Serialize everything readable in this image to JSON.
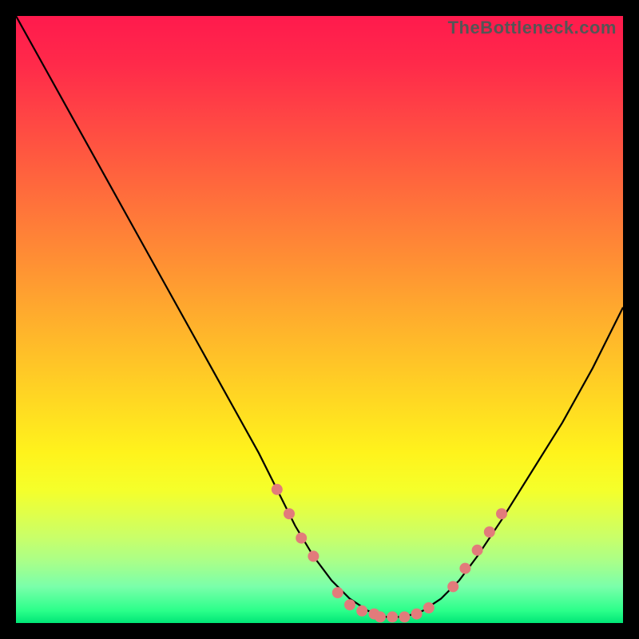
{
  "watermark": "TheBottleneck.com",
  "chart_data": {
    "type": "line",
    "title": "",
    "xlabel": "",
    "ylabel": "",
    "x_range": [
      0,
      100
    ],
    "y_range": [
      0,
      100
    ],
    "curve": {
      "name": "bottleneck-curve",
      "x": [
        0,
        5,
        10,
        15,
        20,
        25,
        30,
        35,
        40,
        43,
        46,
        49,
        52,
        55,
        58,
        61,
        64,
        67,
        70,
        73,
        76,
        80,
        85,
        90,
        95,
        100
      ],
      "y": [
        100,
        91,
        82,
        73,
        64,
        55,
        46,
        37,
        28,
        22,
        16,
        11,
        7,
        4,
        2,
        1,
        1,
        2,
        4,
        7,
        11,
        17,
        25,
        33,
        42,
        52
      ]
    },
    "markers": {
      "name": "highlight-dots",
      "color": "#e27b7b",
      "x": [
        43,
        45,
        47,
        49,
        53,
        55,
        57,
        59,
        60,
        62,
        64,
        66,
        68,
        72,
        74,
        76,
        78,
        80
      ],
      "y": [
        22,
        18,
        14,
        11,
        5,
        3,
        2,
        1.5,
        1,
        1,
        1,
        1.5,
        2.5,
        6,
        9,
        12,
        15,
        18
      ]
    }
  }
}
